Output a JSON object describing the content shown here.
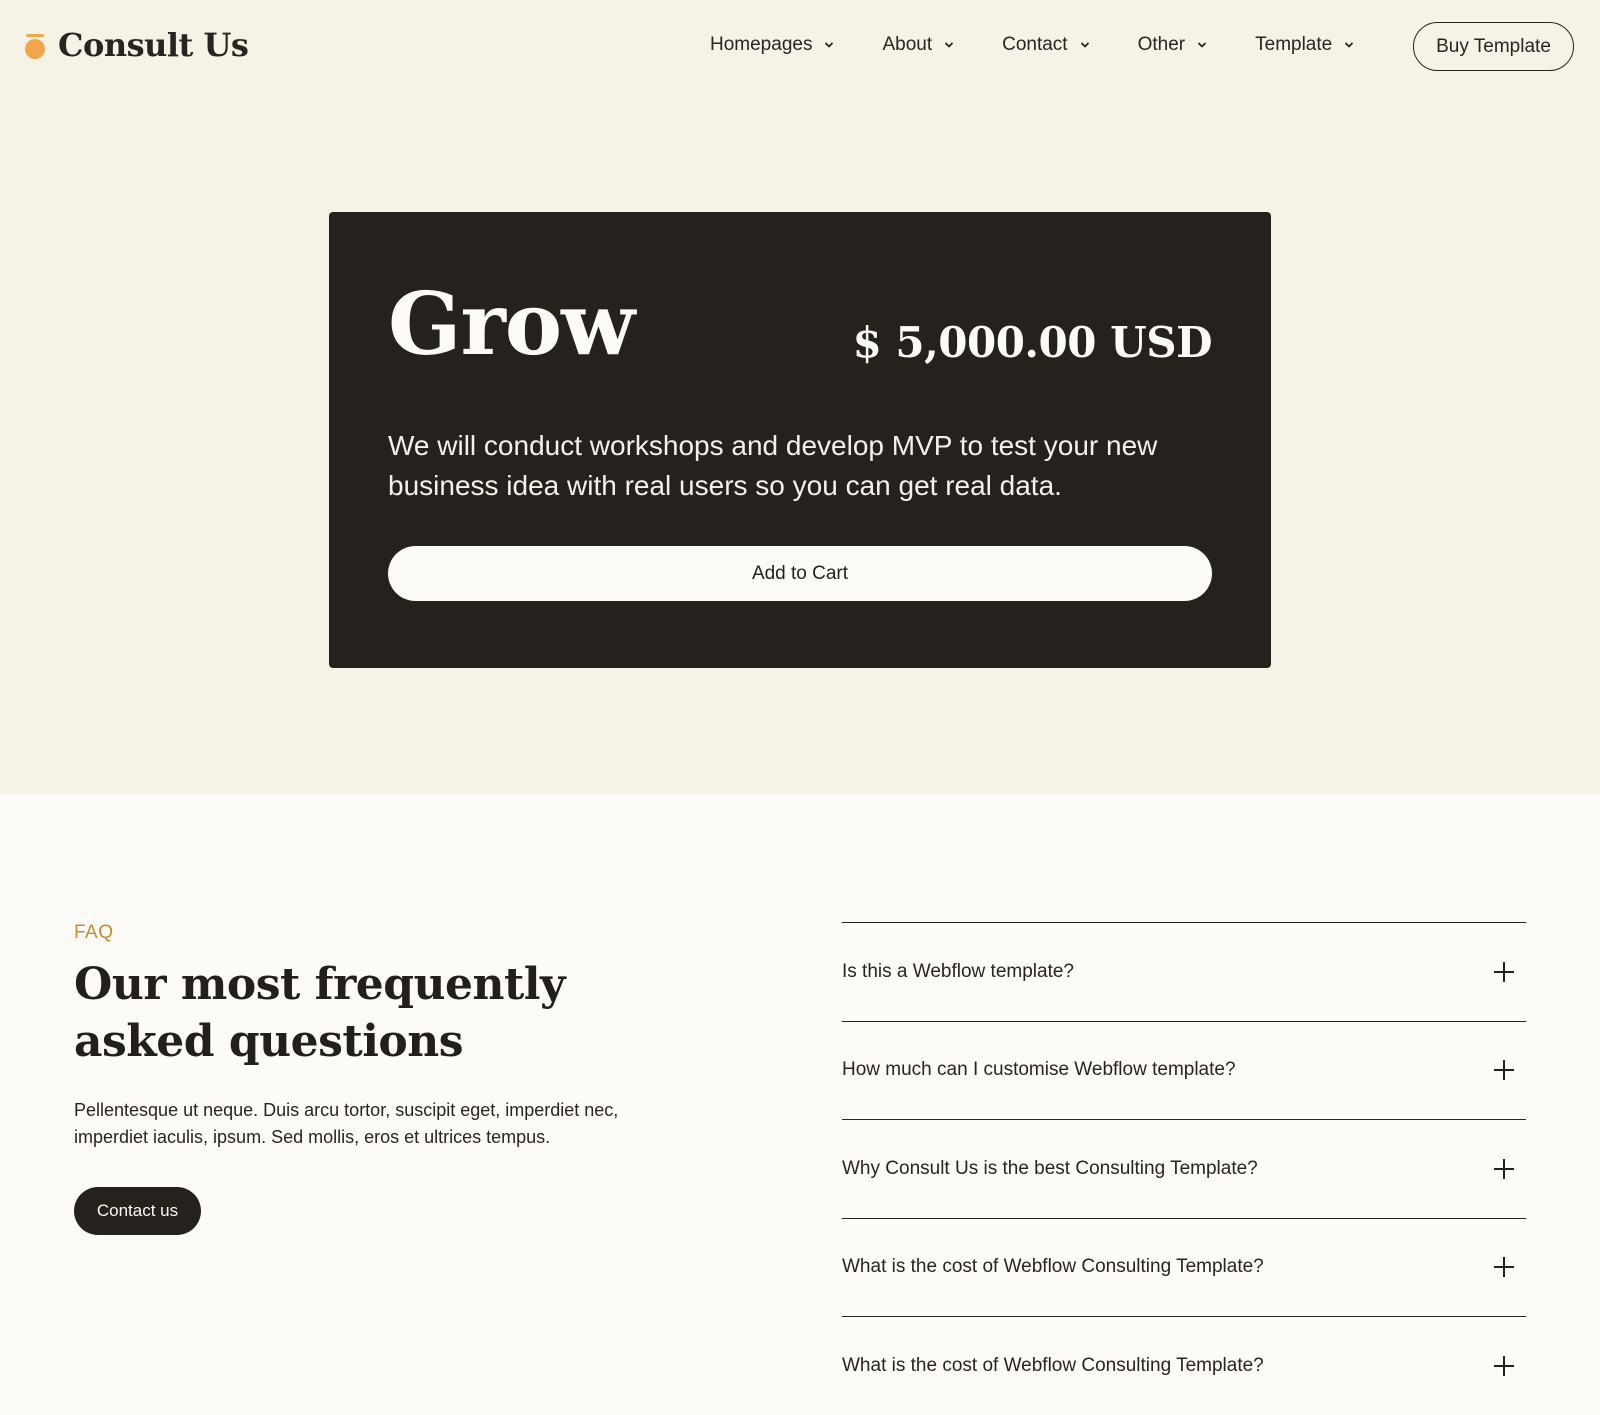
{
  "brand": {
    "name": "Consult Us",
    "accent": "#f2a64a",
    "dark": "#25211d",
    "hero_bg": "#f6f2e5",
    "page_bg": "#fcfbf7",
    "faq_eyebrow_color": "#c98a2e"
  },
  "nav": {
    "items": [
      {
        "label": "Homepages",
        "icon": "chevron-down-icon"
      },
      {
        "label": "About",
        "icon": "chevron-down-icon"
      },
      {
        "label": "Contact",
        "icon": "chevron-down-icon"
      },
      {
        "label": "Other",
        "icon": "chevron-down-icon"
      },
      {
        "label": "Template",
        "icon": "chevron-down-icon"
      }
    ],
    "cta_label": "Buy Template"
  },
  "card": {
    "title": "Grow",
    "price": "$ 5,000.00 USD",
    "description": "We will conduct workshops and develop MVP to test your new business idea with real users so you can get real data.",
    "button_label": "Add to Cart"
  },
  "faq": {
    "eyebrow": "FAQ",
    "heading": "Our most frequently asked questions",
    "body": "Pellentesque ut neque. Duis arcu tortor, suscipit eget, imperdiet nec, imperdiet iaculis, ipsum. Sed mollis, eros et ultrices tempus.",
    "contact_label": "Contact us",
    "items": [
      {
        "question": "Is this a Webflow template?",
        "icon": "plus-icon"
      },
      {
        "question": "How much can I customise Webflow template?",
        "icon": "plus-icon"
      },
      {
        "question": "Why Consult Us is the best Consulting Template?",
        "icon": "plus-icon"
      },
      {
        "question": "What is the cost of Webflow Consulting Template?",
        "icon": "plus-icon"
      },
      {
        "question": "What is the cost of Webflow Consulting Template?",
        "icon": "plus-icon"
      }
    ]
  }
}
